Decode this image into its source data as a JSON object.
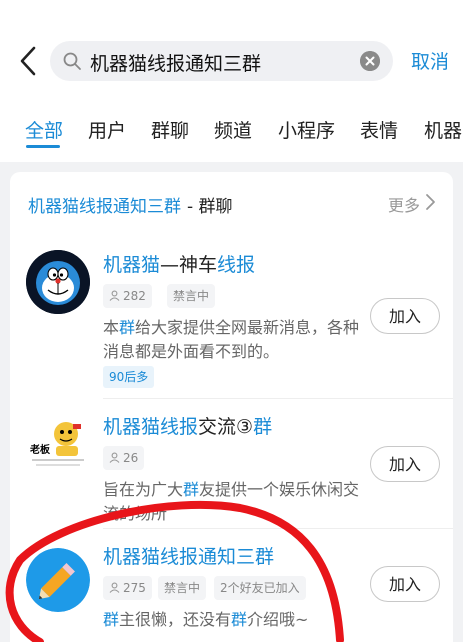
{
  "search": {
    "query": "机器猫线报通知三群",
    "cancel_label": "取消"
  },
  "tabs": [
    {
      "label": "全部",
      "active": true
    },
    {
      "label": "用户"
    },
    {
      "label": "群聊"
    },
    {
      "label": "频道"
    },
    {
      "label": "小程序"
    },
    {
      "label": "表情"
    },
    {
      "label": "机器"
    }
  ],
  "section": {
    "title_highlight": "机器猫线报通知三群",
    "title_rest": "- 群聊",
    "more_label": "更多"
  },
  "groups": [
    {
      "name_parts": [
        {
          "text": "机器猫",
          "hl": true
        },
        {
          "text": "—神车",
          "hl": false
        },
        {
          "text": "线报",
          "hl": true
        }
      ],
      "members": "282",
      "chips": [
        "禁言中"
      ],
      "desc_parts": [
        {
          "text": "本",
          "hl": false
        },
        {
          "text": "群",
          "hl": true
        },
        {
          "text": "给大家提供全网最新消息，各种消息都是外面看不到的。",
          "hl": false
        }
      ],
      "tag": "90后多",
      "join_label": "加入"
    },
    {
      "name_parts": [
        {
          "text": "机器猫线报",
          "hl": true
        },
        {
          "text": "交流③",
          "hl": false
        },
        {
          "text": "群",
          "hl": true
        }
      ],
      "members": "26",
      "chips": [],
      "avatar_text": "老板",
      "desc_parts": [
        {
          "text": "旨在为广大",
          "hl": false
        },
        {
          "text": "群",
          "hl": true
        },
        {
          "text": "友提供一个娱乐休闲交流的场所",
          "hl": false
        }
      ],
      "join_label": "加入"
    },
    {
      "name_parts": [
        {
          "text": "机器猫线报通知三群",
          "hl": true
        }
      ],
      "members": "275",
      "chips": [
        "禁言中",
        "2个好友已加入"
      ],
      "desc_parts": [
        {
          "text": "群",
          "hl": true
        },
        {
          "text": "主很懒，还没有",
          "hl": false
        },
        {
          "text": "群",
          "hl": true
        },
        {
          "text": "介绍哦~",
          "hl": false
        }
      ],
      "join_label": "加入"
    }
  ]
}
